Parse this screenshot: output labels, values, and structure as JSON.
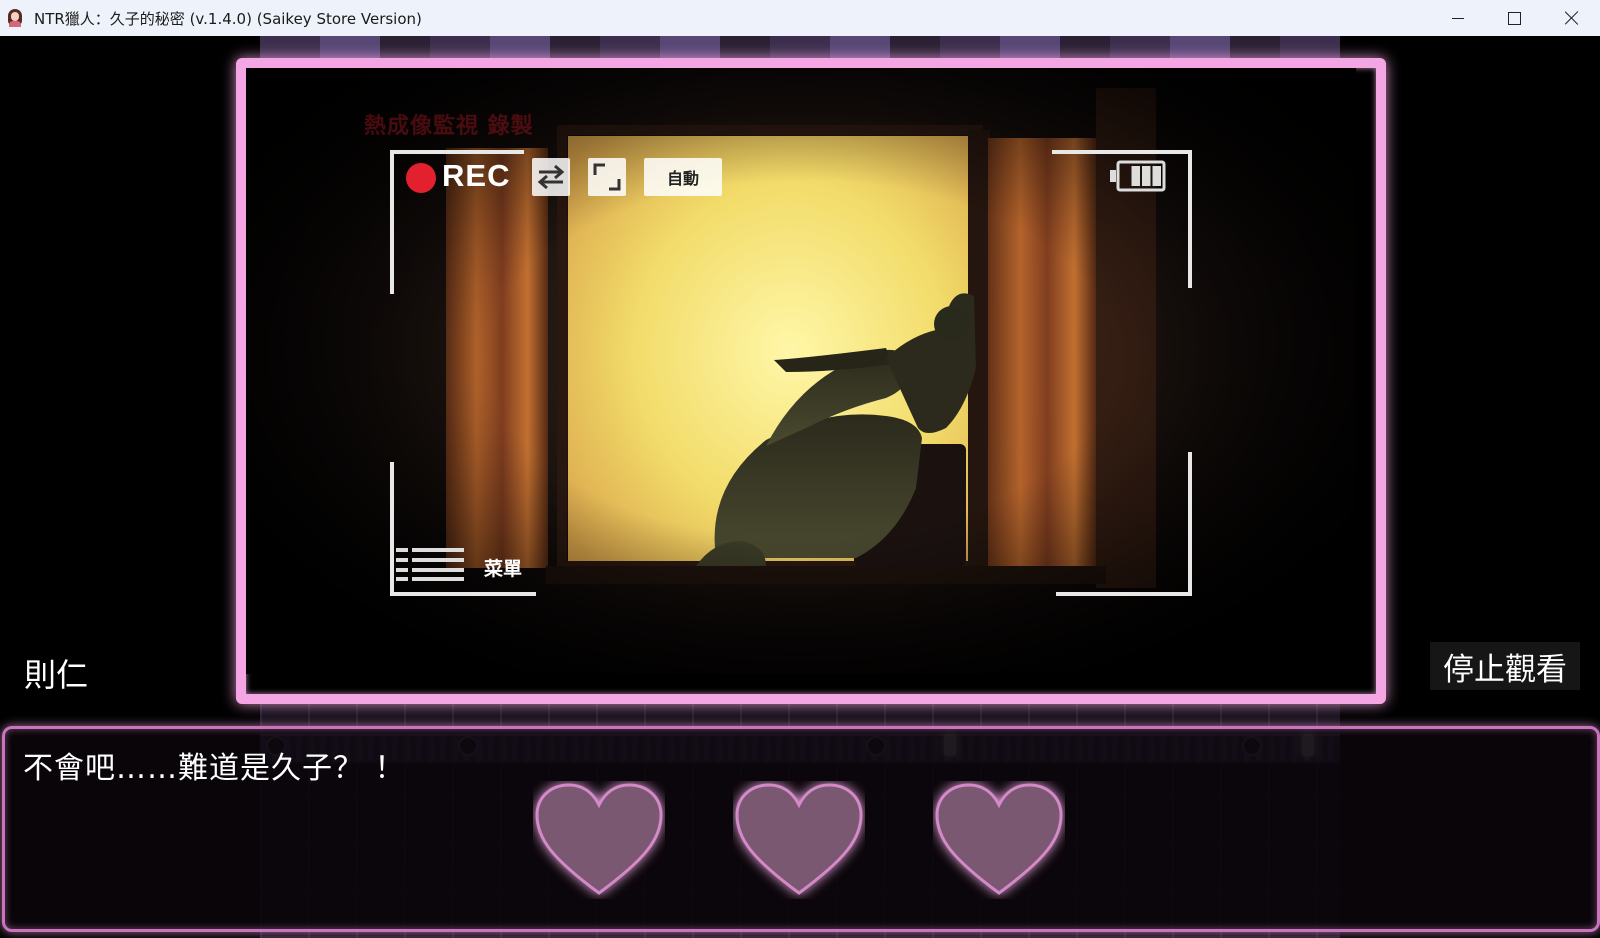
{
  "window": {
    "title": "NTR獵人：久子的秘密 (v.1.4.0) (Saikey Store Version)"
  },
  "camera_hud": {
    "rec_label": "REC",
    "auto_label": "自動",
    "menu_label": "菜單",
    "battery_level": 3,
    "battery_max": 4,
    "ghost_heading": "熱成像監視 錄製"
  },
  "dialogue": {
    "speaker": "則仁",
    "text": "不會吧……難道是久子？ ！",
    "stop_label": "停止觀看",
    "hearts": [
      "heart",
      "heart",
      "heart"
    ]
  },
  "colors": {
    "frame_border": "#f4a6e4",
    "rec_dot": "#e3202e",
    "dialog_border": "#c974bd",
    "heart_fill": "#7a5872"
  }
}
